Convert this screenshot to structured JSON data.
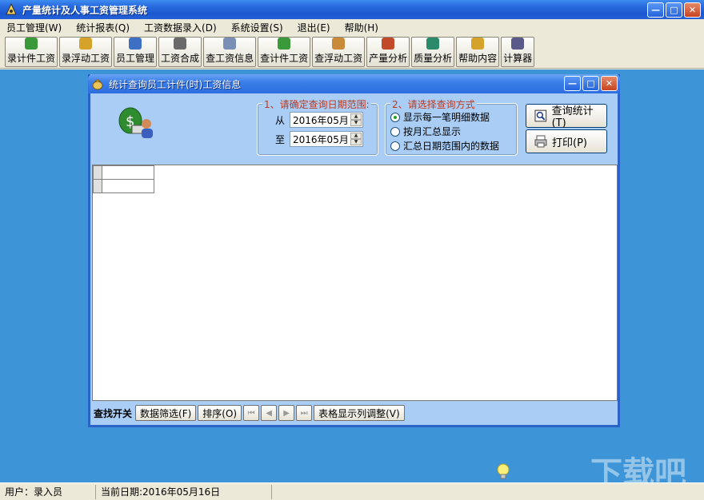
{
  "app": {
    "title": "产量统计及人事工资管理系统",
    "controls": {
      "minimize": "—",
      "maximize": "□",
      "close": "✕"
    }
  },
  "menu": [
    "员工管理(W)",
    "统计报表(Q)",
    "工资数据录入(D)",
    "系统设置(S)",
    "退出(E)",
    "帮助(H)"
  ],
  "toolbar": [
    {
      "label": "录计件工资",
      "icon": "money-bag-icon",
      "color": "#3a9a3a"
    },
    {
      "label": "录浮动工资",
      "icon": "money-bag-icon",
      "color": "#d6a32a"
    },
    {
      "label": "员工管理",
      "icon": "people-icon",
      "color": "#3d6fc2"
    },
    {
      "label": "工资合成",
      "icon": "calculator-icon",
      "color": "#6a6a6a"
    },
    {
      "label": "查工资信息",
      "icon": "search-icon",
      "color": "#7a8fb5"
    },
    {
      "label": "查计件工资",
      "icon": "money-bag-icon",
      "color": "#3a9a3a"
    },
    {
      "label": "查浮动工资",
      "icon": "money-bag-icon",
      "color": "#c98b3a"
    },
    {
      "label": "产量分析",
      "icon": "chart-icon",
      "color": "#c24a2a"
    },
    {
      "label": "质量分析",
      "icon": "chart-icon",
      "color": "#2a8a6a"
    },
    {
      "label": "帮助内容",
      "icon": "help-icon",
      "color": "#d6a32a"
    },
    {
      "label": "计算器",
      "icon": "calculator-icon",
      "color": "#5a5a8a"
    }
  ],
  "child": {
    "title": "统计查询员工计件(时)工资信息",
    "date_group": {
      "legend": "1、请确定查询日期范围:",
      "from_label": "从",
      "from_value": "2016年05月",
      "to_label": "至",
      "to_value": "2016年05月"
    },
    "mode_group": {
      "legend": "2、请选择查询方式",
      "options": [
        {
          "label": "显示每一笔明细数据",
          "selected": true
        },
        {
          "label": "按月汇总显示",
          "selected": false
        },
        {
          "label": "汇总日期范围内的数据",
          "selected": false
        }
      ]
    },
    "buttons": {
      "query": "查询统计(T)",
      "print": "打印(P)"
    },
    "bottom": {
      "find_label": "查找开关",
      "filter": "数据筛选(F)",
      "sort": "排序(O)",
      "columns": "表格显示列调整(V)"
    }
  },
  "status": {
    "user": "用户：录入员",
    "date": "当前日期:2016年05月16日"
  },
  "watermark": "下载吧"
}
